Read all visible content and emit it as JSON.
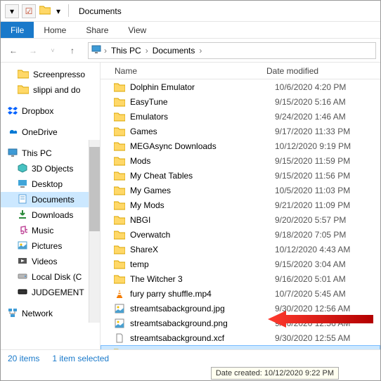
{
  "window": {
    "title": "Documents"
  },
  "titlebar_controls": {
    "dropdown": "▾",
    "checkbox": "☑"
  },
  "ribbon": {
    "file": "File",
    "home": "Home",
    "share": "Share",
    "view": "View"
  },
  "breadcrumb": {
    "root": "This PC",
    "current": "Documents"
  },
  "tree": {
    "quick": [
      {
        "label": "Screenpresso"
      },
      {
        "label": "slippi and do"
      }
    ],
    "dropbox": "Dropbox",
    "onedrive": "OneDrive",
    "thispc": "This PC",
    "pc_items": [
      {
        "label": "3D Objects"
      },
      {
        "label": "Desktop"
      },
      {
        "label": "Documents",
        "selected": true
      },
      {
        "label": "Downloads"
      },
      {
        "label": "Music"
      },
      {
        "label": "Pictures"
      },
      {
        "label": "Videos"
      },
      {
        "label": "Local Disk (C"
      },
      {
        "label": "JUDGEMENT"
      }
    ],
    "network": "Network"
  },
  "columns": {
    "name": "Name",
    "date": "Date modified"
  },
  "rows": [
    {
      "icon": "folder",
      "name": "Dolphin Emulator",
      "date": "10/6/2020 4:20 PM"
    },
    {
      "icon": "folder",
      "name": "EasyTune",
      "date": "9/15/2020 5:16 AM"
    },
    {
      "icon": "folder",
      "name": "Emulators",
      "date": "9/24/2020 1:46 AM"
    },
    {
      "icon": "folder",
      "name": "Games",
      "date": "9/17/2020 11:33 PM"
    },
    {
      "icon": "folder",
      "name": "MEGAsync Downloads",
      "date": "10/12/2020 9:19 PM"
    },
    {
      "icon": "folder",
      "name": "Mods",
      "date": "9/15/2020 11:59 PM"
    },
    {
      "icon": "folder",
      "name": "My Cheat Tables",
      "date": "9/15/2020 11:56 PM"
    },
    {
      "icon": "folder",
      "name": "My Games",
      "date": "10/5/2020 11:03 PM"
    },
    {
      "icon": "folder",
      "name": "My Mods",
      "date": "9/21/2020 11:09 PM"
    },
    {
      "icon": "folder",
      "name": "NBGI",
      "date": "9/20/2020 5:57 PM"
    },
    {
      "icon": "folder",
      "name": "Overwatch",
      "date": "9/18/2020 7:05 PM"
    },
    {
      "icon": "folder",
      "name": "ShareX",
      "date": "10/12/2020 4:43 AM"
    },
    {
      "icon": "folder",
      "name": "temp",
      "date": "9/15/2020 3:04 AM"
    },
    {
      "icon": "folder",
      "name": "The Witcher 3",
      "date": "9/16/2020 5:01 AM"
    },
    {
      "icon": "vlc",
      "name": "fury parry shuffle.mp4",
      "date": "10/7/2020 5:45 AM"
    },
    {
      "icon": "image",
      "name": "streamtsabackground.jpg",
      "date": "9/30/2020 12:56 AM"
    },
    {
      "icon": "image",
      "name": "streamtsabackground.png",
      "date": "9/30/2020 12:56 AM"
    },
    {
      "icon": "file",
      "name": "streamtsabackground.xcf",
      "date": "9/30/2020 12:55 AM"
    },
    {
      "icon": "folder",
      "name": "Dolphin & Slippi",
      "date": "",
      "selected": true
    }
  ],
  "status": {
    "count": "20 items",
    "selection": "1 item selected"
  },
  "tooltip": "Date created: 10/12/2020 9:22 PM"
}
